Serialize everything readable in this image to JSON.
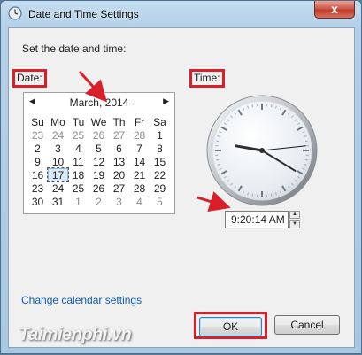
{
  "window": {
    "title": "Date and Time Settings",
    "close_label": "x"
  },
  "main": {
    "heading": "Set the date and time:",
    "date_label": "Date:",
    "time_label": "Time:"
  },
  "calendar": {
    "month_year": "March, 2014",
    "prev_arrow": "◀",
    "next_arrow": "▶",
    "weekdays": [
      "Su",
      "Mo",
      "Tu",
      "We",
      "Th",
      "Fr",
      "Sa"
    ],
    "weeks": [
      [
        "23",
        "24",
        "25",
        "26",
        "27",
        "28",
        "1"
      ],
      [
        "2",
        "3",
        "4",
        "5",
        "6",
        "7",
        "8"
      ],
      [
        "9",
        "10",
        "11",
        "12",
        "13",
        "14",
        "15"
      ],
      [
        "16",
        "17",
        "18",
        "19",
        "20",
        "21",
        "22"
      ],
      [
        "23",
        "24",
        "25",
        "26",
        "27",
        "28",
        "29"
      ],
      [
        "30",
        "31",
        "1",
        "2",
        "3",
        "4",
        "5"
      ]
    ],
    "selected_day": "17"
  },
  "clock": {
    "hour": 9,
    "minute": 20,
    "second": 14
  },
  "time_field": {
    "value": "9:20:14 AM",
    "up": "▲",
    "down": "▼"
  },
  "footer": {
    "calendar_link": "Change calendar settings",
    "ok_label": "OK",
    "cancel_label": "Cancel"
  },
  "watermark": {
    "text": "Taimienphi.vn"
  },
  "colors": {
    "highlight": "#d81f2a",
    "link": "#0f5fb0"
  }
}
